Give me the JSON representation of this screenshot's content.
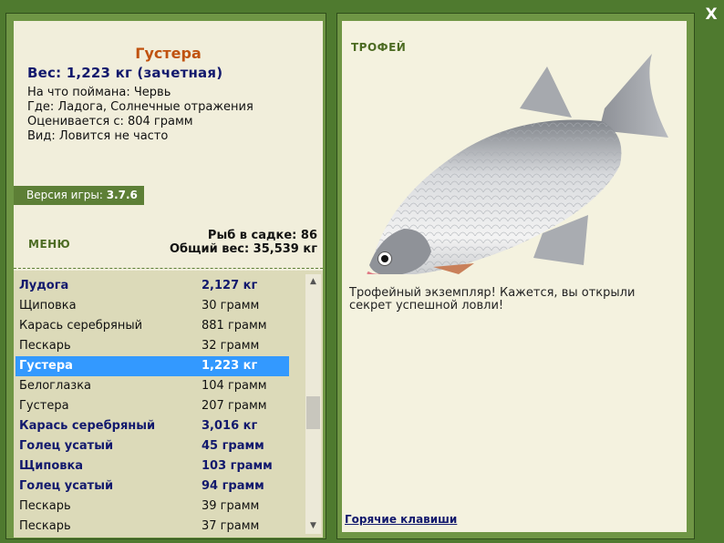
{
  "fish": {
    "name": "Густера",
    "weight_line": "Вес: 1,223 кг (зачетная)",
    "bait": "На что поймана: Червь",
    "location": "Где: Ладога, Солнечные отражения",
    "valued": "Оценивается с: 804 грамм",
    "kind": "Вид: Ловится не часто"
  },
  "version": {
    "label": "Версия игры:",
    "value": "3.7.6"
  },
  "menu_label": "МЕНЮ",
  "stats": {
    "cage": "Рыб в садке: 86",
    "total": "Общий вес: 35,539 кг"
  },
  "catch_list": [
    {
      "name": "Лудога",
      "weight": "2,127 кг",
      "bold": true
    },
    {
      "name": "Щиповка",
      "weight": "30 грамм",
      "bold": false
    },
    {
      "name": "Карась серебряный",
      "weight": "881 грамм",
      "bold": false
    },
    {
      "name": "Пескарь",
      "weight": "32 грамм",
      "bold": false
    },
    {
      "name": "Густера",
      "weight": "1,223 кг",
      "bold": true,
      "selected": true
    },
    {
      "name": "Белоглазка",
      "weight": "104 грамм",
      "bold": false
    },
    {
      "name": "Густера",
      "weight": "207 грамм",
      "bold": false
    },
    {
      "name": "Карась серебряный",
      "weight": "3,016 кг",
      "bold": true
    },
    {
      "name": "Голец усатый",
      "weight": "45 грамм",
      "bold": true
    },
    {
      "name": "Щиповка",
      "weight": "103 грамм",
      "bold": true
    },
    {
      "name": "Голец усатый",
      "weight": "94 грамм",
      "bold": true
    },
    {
      "name": "Пескарь",
      "weight": "39 грамм",
      "bold": false
    },
    {
      "name": "Пескарь",
      "weight": "37 грамм",
      "bold": false
    }
  ],
  "trophy": {
    "label": "ТРОФЕЙ",
    "text": "Трофейный экземпляр! Кажется, вы открыли секрет успешной ловли!"
  },
  "hotkeys_label": "Горячие клавиши",
  "close_label": "X",
  "colors": {
    "background": "#4f7a2f",
    "panel": "#f1eedb",
    "list": "#dcdab9",
    "accent_title": "#c0520f",
    "accent_bold": "#12196d",
    "selection": "#3399ff"
  }
}
